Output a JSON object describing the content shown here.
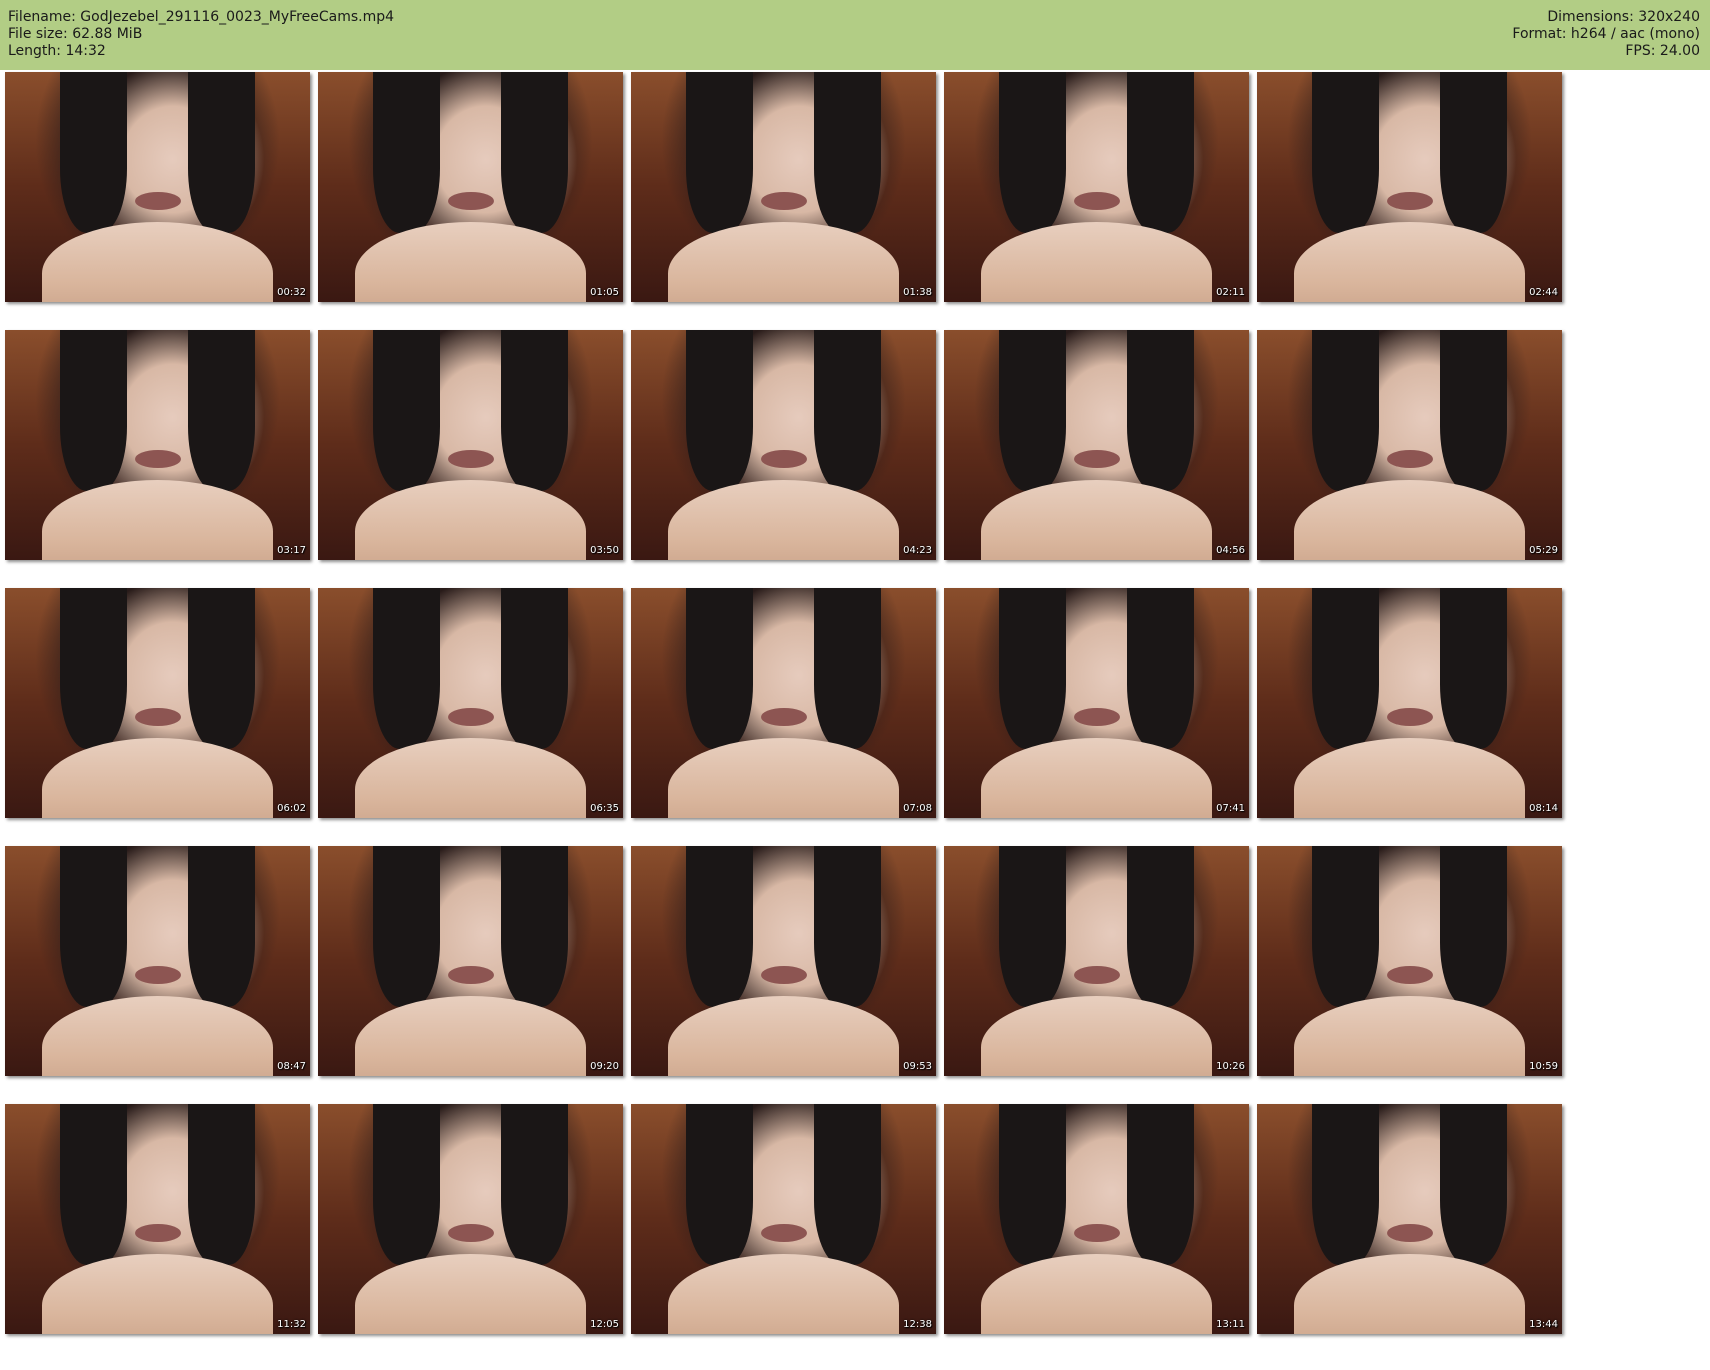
{
  "header": {
    "filename": "Filename: GodJezebel_291116_0023_MyFreeCams.mp4",
    "filesize": "File size: 62.88 MiB",
    "length": "Length: 14:32",
    "dimensions": "Dimensions: 320x240",
    "format": "Format: h264 / aac (mono)",
    "fps": "FPS: 24.00"
  },
  "colors": {
    "header_bg": "#b2cd85",
    "page_bg": "#ffffff"
  },
  "thumbnails": [
    {
      "time": "00:32"
    },
    {
      "time": "01:05"
    },
    {
      "time": "01:38"
    },
    {
      "time": "02:11"
    },
    {
      "time": "02:44"
    },
    {
      "time": "03:17"
    },
    {
      "time": "03:50"
    },
    {
      "time": "04:23"
    },
    {
      "time": "04:56"
    },
    {
      "time": "05:29"
    },
    {
      "time": "06:02"
    },
    {
      "time": "06:35"
    },
    {
      "time": "07:08"
    },
    {
      "time": "07:41"
    },
    {
      "time": "08:14"
    },
    {
      "time": "08:47"
    },
    {
      "time": "09:20"
    },
    {
      "time": "09:53"
    },
    {
      "time": "10:26"
    },
    {
      "time": "10:59"
    },
    {
      "time": "11:32"
    },
    {
      "time": "12:05"
    },
    {
      "time": "12:38"
    },
    {
      "time": "13:11"
    },
    {
      "time": "13:44"
    }
  ]
}
